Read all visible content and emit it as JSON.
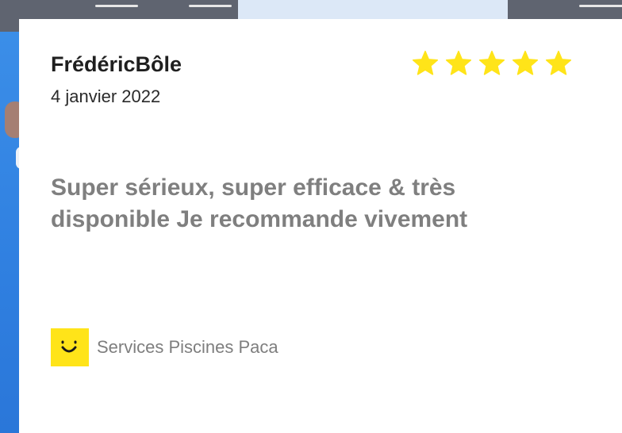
{
  "review": {
    "author": "FrédéricBôle",
    "date": "4 janvier 2022",
    "rating": 5,
    "rating_max": 5,
    "text": "Super sérieux, super efficace & très disponible Je recommande vivement",
    "company_name": "Services Piscines Paca"
  },
  "colors": {
    "star": "#ffe419",
    "logo_bg": "#ffe419",
    "text_review": "#7f7f7f",
    "card_bg": "#ffffff"
  },
  "icons": {
    "star": "star-icon",
    "logo": "smile-logo-icon"
  }
}
